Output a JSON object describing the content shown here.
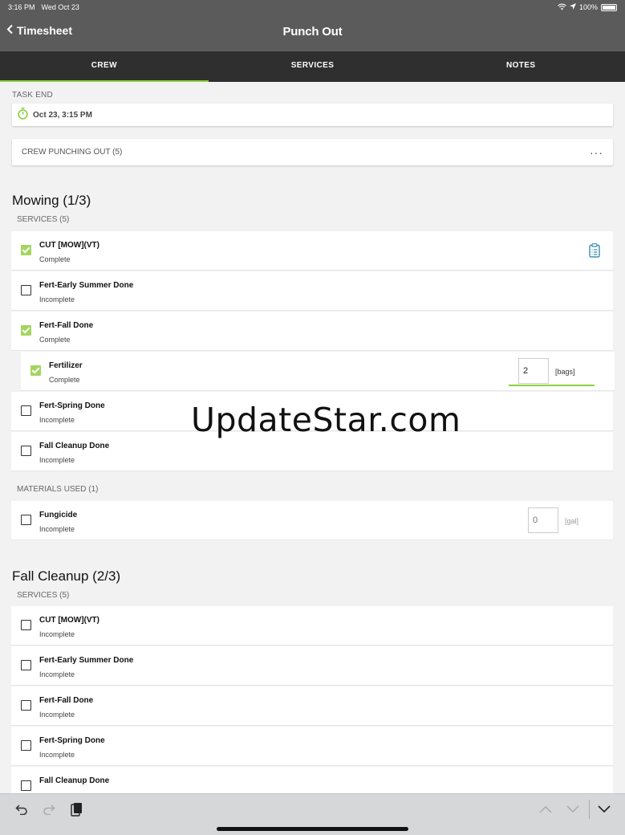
{
  "status_bar": {
    "time": "3:16 PM",
    "date": "Wed Oct 23",
    "battery": "100%"
  },
  "nav": {
    "back_label": "Timesheet",
    "title": "Punch Out"
  },
  "tabs": [
    {
      "label": "CREW",
      "active": true
    },
    {
      "label": "SERVICES",
      "active": false
    },
    {
      "label": "NOTES",
      "active": false
    }
  ],
  "task_end": {
    "label": "TASK END",
    "value": "Oct 23, 3:15 PM"
  },
  "crew": {
    "label": "CREW PUNCHING OUT (5)",
    "more": "···"
  },
  "mowing": {
    "title": "Mowing (1/3)",
    "services_label": "SERVICES (5)",
    "services": [
      {
        "name": "CUT [MOW](VT)",
        "status": "Complete",
        "checked": true
      },
      {
        "name": "Fert-Early Summer Done",
        "status": "Incomplete",
        "checked": false
      },
      {
        "name": "Fert-Fall Done",
        "status": "Complete",
        "checked": true
      },
      {
        "name": "Fertilizer",
        "status": "Complete",
        "checked": true,
        "qty": "2",
        "unit": "[bags]"
      },
      {
        "name": "Fert-Spring Done",
        "status": "Incomplete",
        "checked": false
      },
      {
        "name": "Fall Cleanup Done",
        "status": "Incomplete",
        "checked": false
      }
    ],
    "materials_label": "MATERIALS USED (1)",
    "materials": [
      {
        "name": "Fungicide",
        "status": "Incomplete",
        "checked": false,
        "qty_placeholder": "0",
        "unit": "[gal]"
      }
    ]
  },
  "fall_cleanup": {
    "title": "Fall Cleanup (2/3)",
    "services_label": "SERVICES (5)",
    "services": [
      {
        "name": "CUT [MOW](VT)",
        "status": "Incomplete",
        "checked": false
      },
      {
        "name": "Fert-Early Summer Done",
        "status": "Incomplete",
        "checked": false
      },
      {
        "name": "Fert-Fall Done",
        "status": "Incomplete",
        "checked": false
      },
      {
        "name": "Fert-Spring Done",
        "status": "Incomplete",
        "checked": false
      },
      {
        "name": "Fall Cleanup Done",
        "status": "",
        "checked": false
      }
    ]
  },
  "watermark": "UpdateStar.com",
  "colors": {
    "accent": "#8ccf3f",
    "check_fill": "#a4d65e",
    "header": "#5b5b5b",
    "tab_bar": "#2f2f2f",
    "clip_icon": "#3c8fb0"
  },
  "icons": [
    "chevron-left-icon",
    "stopwatch-icon",
    "more-icon",
    "clipboard-icon",
    "undo-icon",
    "redo-icon",
    "paste-icon",
    "chevron-up-icon",
    "chevron-down-icon",
    "keyboard-dismiss-icon",
    "wifi-icon",
    "location-icon",
    "battery-icon"
  ]
}
